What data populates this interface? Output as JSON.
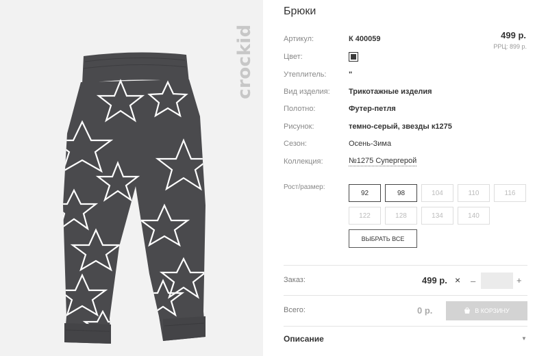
{
  "product": {
    "title": "Брюки",
    "brand": "crockid",
    "price": "499 р.",
    "ppc": "РРЦ: 899 р."
  },
  "specs": {
    "article": {
      "label": "Артикул:",
      "value": "К 400059"
    },
    "color": {
      "label": "Цвет:",
      "swatch": "#3b3b3b"
    },
    "insulation": {
      "label": "Утеплитель:",
      "value": "\""
    },
    "item_type": {
      "label": "Вид изделия:",
      "value": "Трикотажные изделия"
    },
    "fabric": {
      "label": "Полотно:",
      "value": "Футер-петля"
    },
    "pattern": {
      "label": "Рисунок:",
      "value": "темно-серый, звезды к1275"
    },
    "season": {
      "label": "Сезон:",
      "value": "Осень-Зима"
    },
    "collection": {
      "label": "Коллекция:",
      "value": "№1275 Супергерой"
    }
  },
  "sizes": {
    "label": "Рост/размер:",
    "items": [
      {
        "label": "92",
        "available": true
      },
      {
        "label": "98",
        "available": true
      },
      {
        "label": "104",
        "available": false
      },
      {
        "label": "110",
        "available": false
      },
      {
        "label": "116",
        "available": false
      },
      {
        "label": "122",
        "available": false
      },
      {
        "label": "128",
        "available": false
      },
      {
        "label": "134",
        "available": false
      },
      {
        "label": "140",
        "available": false
      }
    ],
    "select_all": "ВЫБРАТЬ ВСЕ"
  },
  "order": {
    "label": "Заказ:",
    "price": "499 р.",
    "times": "×",
    "minus": "–",
    "plus": "+",
    "quantity": ""
  },
  "total": {
    "label": "Всего:",
    "value": "0 р.",
    "cart_button": "В КОРЗИНУ"
  },
  "description": {
    "label": "Описание",
    "chevron": "▼"
  },
  "colors": {
    "pants": "#4a4a4d",
    "stars": "#ffffff",
    "photo_bg": "#f2f2f2"
  }
}
